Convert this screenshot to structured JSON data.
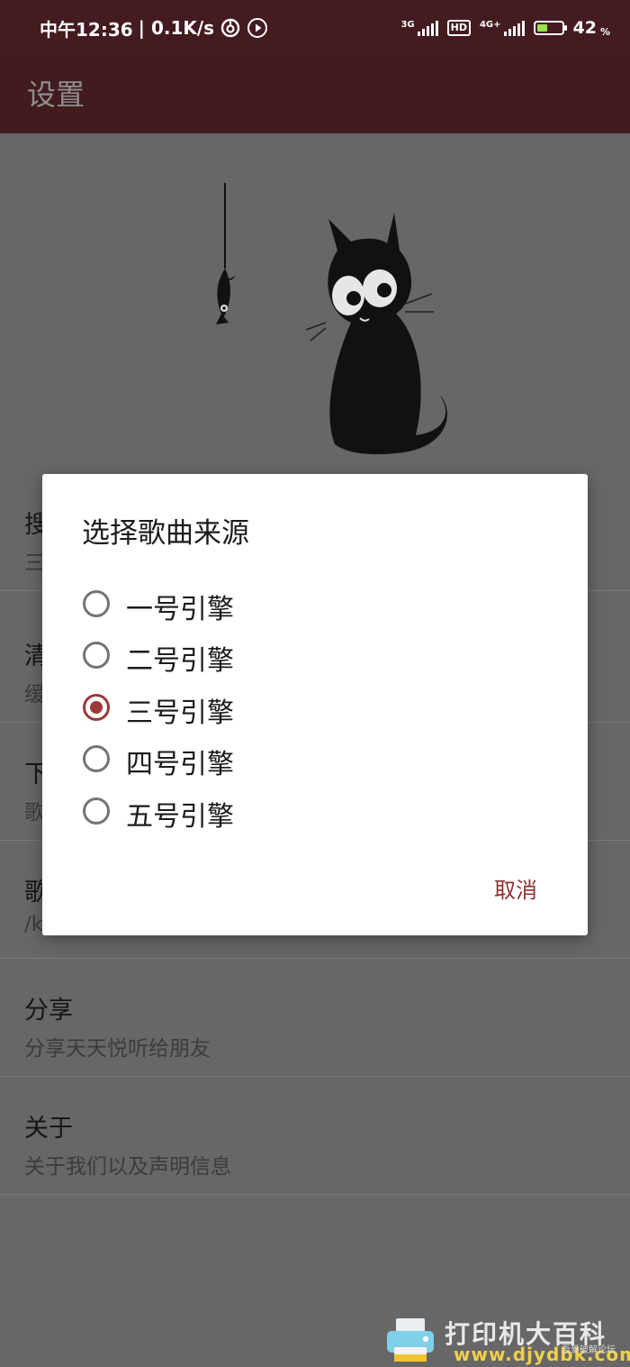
{
  "status_bar": {
    "time": "中午12:36",
    "speed": "| 0.1K/s",
    "network1": "3G",
    "hd": "HD",
    "network2": "4G+",
    "battery_percent": "42",
    "battery_unit": "%",
    "battery_level": 0.42,
    "battery_color": "#9be34c"
  },
  "app_bar": {
    "title": "设置"
  },
  "settings": [
    {
      "title": "搜",
      "subtitle": "三"
    },
    {
      "title": "清",
      "subtitle": "缓"
    },
    {
      "title": "下",
      "subtitle": "歌"
    },
    {
      "title": "歌",
      "subtitle": "/k"
    },
    {
      "title": "分享",
      "subtitle": "分享天天悦听给朋友"
    },
    {
      "title": "关于",
      "subtitle": "关于我们以及声明信息"
    }
  ],
  "dialog": {
    "title": "选择歌曲来源",
    "options": [
      {
        "label": "一号引擎",
        "checked": false
      },
      {
        "label": "二号引擎",
        "checked": false
      },
      {
        "label": "三号引擎",
        "checked": true
      },
      {
        "label": "四号引擎",
        "checked": false
      },
      {
        "label": "五号引擎",
        "checked": false
      }
    ],
    "cancel_label": "取消",
    "accent_color": "#9a3a3a"
  },
  "watermark": {
    "text": "打印机大百科",
    "domain": "www.djydbk.com",
    "small": "吾爱破解论坛"
  },
  "colors": {
    "status_bar_bg": "#441b20",
    "app_bar_bg": "#421b1f",
    "scrim": "#676767",
    "cancel_text": "#8e3132"
  }
}
